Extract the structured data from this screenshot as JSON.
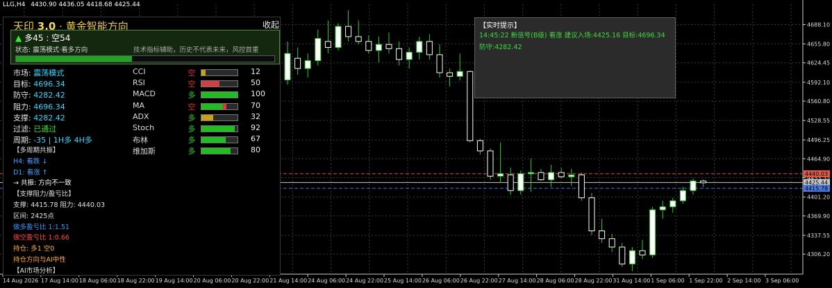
{
  "header": {
    "symbol": "LLG,H4",
    "ohlc": "4430.90 4436.05 4418.68 4425.44"
  },
  "panel": {
    "title_prefix": "天印",
    "title_version": "3.0",
    "title_suffix": "· 黄金智能方向",
    "collapse_label": "收起",
    "collapse_arrow": "▼",
    "status_arrow": "▲",
    "status_summary": "多45 : 空54",
    "status_line": "状态: 震荡模式·看多方向",
    "disclaimer": "技术指标辅助，历史不代表未来，风控首重",
    "progress": 0.45,
    "left_rows": [
      {
        "key": "市场: ",
        "value": "震荡模式"
      },
      {
        "key": "目标: ",
        "value": "4696.34"
      },
      {
        "key": "防守: ",
        "value": "4282.42"
      },
      {
        "key": "阻力: ",
        "value": "4696.34"
      },
      {
        "key": "支撑: ",
        "value": "4282.42"
      },
      {
        "key": "过滤: ",
        "value": "已通过"
      },
      {
        "key": "周期: ",
        "value": "-35 | 1H多 4H多"
      }
    ],
    "indicators": [
      {
        "name": "CCI",
        "dir": "空",
        "color": "#e03030",
        "score": 12,
        "value": "12"
      },
      {
        "name": "RSI",
        "dir": "空",
        "color": "#e03030",
        "score": 50,
        "value": "50"
      },
      {
        "name": "MACD",
        "dir": "多",
        "color": "#2fcc2f",
        "score": 100,
        "value": "100"
      },
      {
        "name": "MA",
        "dir": "空",
        "color": "#e03030",
        "score": 70,
        "value": "70"
      },
      {
        "name": "ADX",
        "dir": "多",
        "color": "#2fcc2f",
        "score": 32,
        "value": "32"
      },
      {
        "name": "Stoch",
        "dir": "多",
        "color": "#2fcc2f",
        "score": 92,
        "value": "92"
      },
      {
        "name": "布林",
        "dir": "多",
        "color": "#2fcc2f",
        "score": 67,
        "value": "67"
      },
      {
        "name": "维加斯",
        "dir": "多",
        "color": "#2fcc2f",
        "score": 80,
        "value": "80"
      }
    ],
    "sections": [
      {
        "text": "【多周期共振】",
        "color": "#e0e0e0"
      },
      {
        "text": "H4: 看跌 ↓",
        "color": "#4aa0ff"
      },
      {
        "text": "D1: 看涨 ↑",
        "color": "#4aa0ff"
      },
      {
        "text": "→ 共振: 方向不一致",
        "color": "#ffffff"
      },
      {
        "text": "【支撑阻力/盈亏比】",
        "color": "#e0e0e0"
      },
      {
        "text": "支撑: 4415.78  阻力: 4440.03",
        "color": "#e0e0e0"
      },
      {
        "text": "区间: 2425点",
        "color": "#e0e0e0"
      },
      {
        "text": "做多盈亏比 1:1.51",
        "color": "#3a9bff"
      },
      {
        "text": "做空盈亏比 1:0.66",
        "color": "#ff4a4a"
      },
      {
        "text": "持仓: 多1 空0",
        "color": "#ffb030"
      },
      {
        "text": "持仓方向与AI中性",
        "color": "#ffb030"
      },
      {
        "text": "【AI市场分析】",
        "color": "#e0e0e0"
      }
    ]
  },
  "tooltip": {
    "title": "【实时提示】",
    "line1": "14:45:22 新信号(B级) 看涨 建议入场:4425.16 目标:4696.34",
    "line2": "防守:4282.42"
  },
  "chart_data": {
    "type": "candlestick",
    "y_ticks": [
      4688.1,
      4655.8,
      4624.45,
      4592.1,
      4560.8,
      4528.55,
      4496.25,
      4464.9,
      4433.55,
      4401.2,
      4369.9,
      4337.55,
      4306.2
    ],
    "ylim": [
      4273.0,
      4722.0
    ],
    "x_tick_labels": [
      "14 Aug 2026",
      "17 Aug 14:00",
      "18 Aug 06:00",
      "18 Aug 22:00",
      "19 Aug 14:00",
      "20 Aug 06:00",
      "20 Aug 22:00",
      "21 Aug 14:00",
      "24 Aug 06:00",
      "24 Aug 22:00",
      "25 Aug 14:00",
      "26 Aug 06:00",
      "26 Aug 22:00",
      "27 Aug 14:00",
      "28 Aug 06:00",
      "28 Aug 22:00",
      "31 Aug 14:00",
      "1 Sep 06:00",
      "1 Sep 22:00",
      "2 Sep 14:00",
      "3 Sep 06:00"
    ],
    "price_lines": [
      {
        "value": 4440.03,
        "label": "4440.03",
        "color": "#e05a4a"
      },
      {
        "value": 4425.44,
        "label": "4425.44",
        "color": "#c8c8c8"
      },
      {
        "value": 4415.78,
        "label": "4415.78",
        "color": "#4a7ae0"
      }
    ],
    "candles": [
      {
        "o": 4596,
        "h": 4660,
        "l": 4588,
        "c": 4640
      },
      {
        "o": 4632,
        "h": 4650,
        "l": 4605,
        "c": 4615
      },
      {
        "o": 4615,
        "h": 4640,
        "l": 4600,
        "c": 4628
      },
      {
        "o": 4628,
        "h": 4680,
        "l": 4620,
        "c": 4665
      },
      {
        "o": 4660,
        "h": 4695,
        "l": 4640,
        "c": 4650
      },
      {
        "o": 4650,
        "h": 4690,
        "l": 4645,
        "c": 4685
      },
      {
        "o": 4685,
        "h": 4712,
        "l": 4660,
        "c": 4668
      },
      {
        "o": 4668,
        "h": 4695,
        "l": 4655,
        "c": 4660
      },
      {
        "o": 4660,
        "h": 4670,
        "l": 4640,
        "c": 4645
      },
      {
        "o": 4645,
        "h": 4668,
        "l": 4625,
        "c": 4655
      },
      {
        "o": 4655,
        "h": 4675,
        "l": 4640,
        "c": 4648
      },
      {
        "o": 4648,
        "h": 4660,
        "l": 4620,
        "c": 4630
      },
      {
        "o": 4630,
        "h": 4650,
        "l": 4615,
        "c": 4642
      },
      {
        "o": 4642,
        "h": 4668,
        "l": 4630,
        "c": 4660
      },
      {
        "o": 4660,
        "h": 4672,
        "l": 4630,
        "c": 4638
      },
      {
        "o": 4638,
        "h": 4655,
        "l": 4600,
        "c": 4608
      },
      {
        "o": 4608,
        "h": 4615,
        "l": 4585,
        "c": 4602
      },
      {
        "o": 4602,
        "h": 4640,
        "l": 4595,
        "c": 4610
      },
      {
        "o": 4610,
        "h": 4612,
        "l": 4492,
        "c": 4495
      },
      {
        "o": 4495,
        "h": 4498,
        "l": 4472,
        "c": 4478
      },
      {
        "o": 4478,
        "h": 4482,
        "l": 4430,
        "c": 4436
      },
      {
        "o": 4436,
        "h": 4492,
        "l": 4425,
        "c": 4440
      },
      {
        "o": 4438,
        "h": 4450,
        "l": 4405,
        "c": 4412
      },
      {
        "o": 4412,
        "h": 4445,
        "l": 4405,
        "c": 4440
      },
      {
        "o": 4440,
        "h": 4465,
        "l": 4410,
        "c": 4442
      },
      {
        "o": 4442,
        "h": 4448,
        "l": 4428,
        "c": 4430
      },
      {
        "o": 4430,
        "h": 4455,
        "l": 4418,
        "c": 4442
      },
      {
        "o": 4442,
        "h": 4450,
        "l": 4432,
        "c": 4435
      },
      {
        "o": 4435,
        "h": 4448,
        "l": 4420,
        "c": 4438
      },
      {
        "o": 4438,
        "h": 4442,
        "l": 4395,
        "c": 4400
      },
      {
        "o": 4400,
        "h": 4408,
        "l": 4338,
        "c": 4345
      },
      {
        "o": 4345,
        "h": 4365,
        "l": 4325,
        "c": 4332
      },
      {
        "o": 4332,
        "h": 4340,
        "l": 4310,
        "c": 4318
      },
      {
        "o": 4318,
        "h": 4325,
        "l": 4285,
        "c": 4290
      },
      {
        "o": 4290,
        "h": 4318,
        "l": 4278,
        "c": 4312
      },
      {
        "o": 4312,
        "h": 4330,
        "l": 4298,
        "c": 4305
      },
      {
        "o": 4305,
        "h": 4385,
        "l": 4300,
        "c": 4380
      },
      {
        "o": 4380,
        "h": 4395,
        "l": 4365,
        "c": 4385
      },
      {
        "o": 4385,
        "h": 4400,
        "l": 4375,
        "c": 4395
      },
      {
        "o": 4395,
        "h": 4418,
        "l": 4390,
        "c": 4412
      },
      {
        "o": 4412,
        "h": 4432,
        "l": 4405,
        "c": 4428
      },
      {
        "o": 4428,
        "h": 4430,
        "l": 4418,
        "c": 4425
      }
    ],
    "colors": {
      "bull": "#ffffff",
      "bear": "#ffffff",
      "wick": "#2fcc2f",
      "grid": "#3a3a3a",
      "axis": "#cfcfcf"
    }
  }
}
